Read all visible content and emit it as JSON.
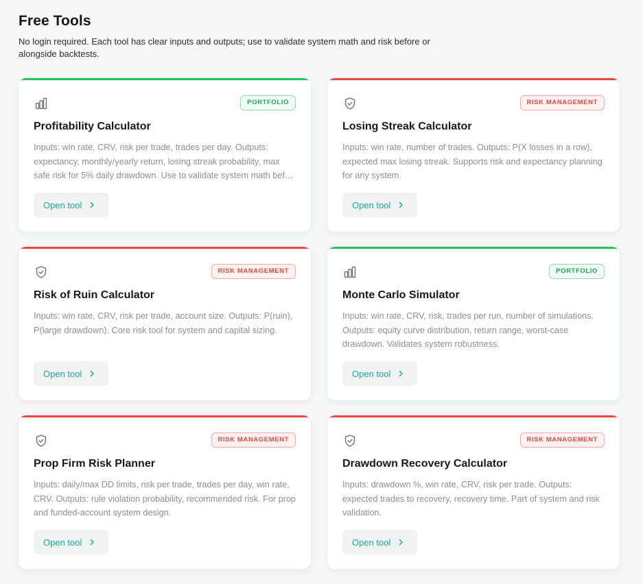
{
  "header": {
    "title": "Free Tools",
    "subtitle": "No login required. Each tool has clear inputs and outputs; use to validate system math and risk before or alongside backtests."
  },
  "colors": {
    "portfolio": "#22c55e",
    "risk": "#e5483f",
    "link": "#16a8a0"
  },
  "cards": [
    {
      "category": "portfolio",
      "icon": "bar-chart-icon",
      "badge": "PORTFOLIO",
      "title": "Profitability Calculator",
      "description": "Inputs: win rate, CRV, risk per trade, trades per day. Outputs: expectancy, monthly/yearly return, losing streak probability, max safe risk for 5% daily drawdown. Use to validate system math before backtesting.",
      "button": "Open tool"
    },
    {
      "category": "risk",
      "icon": "shield-check-icon",
      "badge": "RISK MANAGEMENT",
      "title": "Losing Streak Calculator",
      "description": "Inputs: win rate, number of trades. Outputs: P(X losses in a row), expected max losing streak. Supports risk and expectancy planning for any system.",
      "button": "Open tool"
    },
    {
      "category": "risk",
      "icon": "shield-check-icon",
      "badge": "RISK MANAGEMENT",
      "title": "Risk of Ruin Calculator",
      "description": "Inputs: win rate, CRV, risk per trade, account size. Outputs: P(ruin), P(large drawdown). Core risk tool for system and capital sizing.",
      "button": "Open tool"
    },
    {
      "category": "portfolio",
      "icon": "bar-chart-icon",
      "badge": "PORTFOLIO",
      "title": "Monte Carlo Simulator",
      "description": "Inputs: win rate, CRV, risk, trades per run, number of simulations. Outputs: equity curve distribution, return range, worst-case drawdown. Validates system robustness.",
      "button": "Open tool"
    },
    {
      "category": "risk",
      "icon": "shield-check-icon",
      "badge": "RISK MANAGEMENT",
      "title": "Prop Firm Risk Planner",
      "description": "Inputs: daily/max DD limits, risk per trade, trades per day, win rate, CRV. Outputs: rule violation probability, recommended risk. For prop and funded-account system design.",
      "button": "Open tool"
    },
    {
      "category": "risk",
      "icon": "shield-check-icon",
      "badge": "RISK MANAGEMENT",
      "title": "Drawdown Recovery Calculator",
      "description": "Inputs: drawdown %, win rate, CRV, risk per trade. Outputs: expected trades to recovery, recovery time. Part of system and risk validation.",
      "button": "Open tool"
    }
  ]
}
